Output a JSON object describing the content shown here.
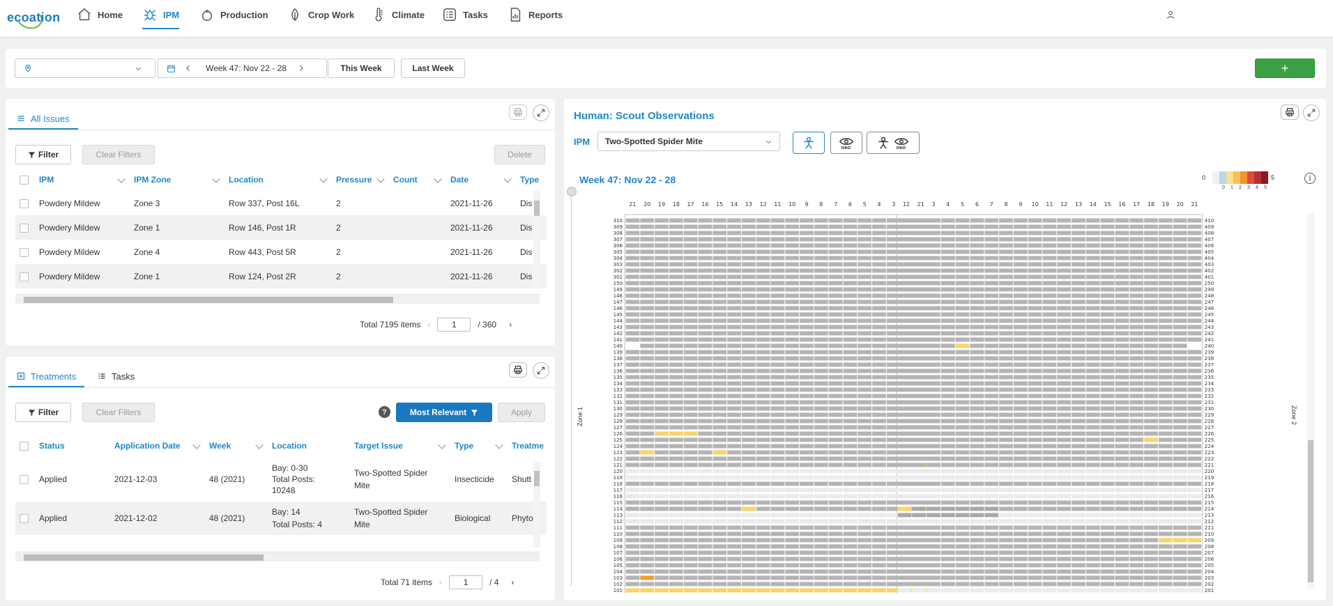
{
  "nav": {
    "logo_text": "ecoation",
    "items": [
      {
        "label": "Home",
        "icon": "home-icon"
      },
      {
        "label": "IPM",
        "icon": "bug-icon",
        "active": true
      },
      {
        "label": "Production",
        "icon": "tomato-icon"
      },
      {
        "label": "Crop Work",
        "icon": "leaf-icon"
      },
      {
        "label": "Climate",
        "icon": "thermometer-icon"
      },
      {
        "label": "Tasks",
        "icon": "checklist-icon"
      },
      {
        "label": "Reports",
        "icon": "report-icon"
      }
    ],
    "user_icon": "user-icon"
  },
  "toolbar": {
    "location_placeholder": "",
    "week_label": "Week 47: Nov 22 - 28",
    "this_week": "This Week",
    "last_week": "Last Week",
    "add_label": "+"
  },
  "issues": {
    "tab_label": "All Issues",
    "filter_label": "Filter",
    "clear_filters_label": "Clear Filters",
    "delete_label": "Delete",
    "columns": [
      "IPM",
      "IPM Zone",
      "Location",
      "Pressure",
      "Count",
      "Date",
      "Type"
    ],
    "rows": [
      {
        "ipm": "Powdery Mildew",
        "zone": "Zone 3",
        "location": "Row 337, Post 16L",
        "pressure": "2",
        "count": "",
        "date": "2021-11-26",
        "type": "Dis"
      },
      {
        "ipm": "Powdery Mildew",
        "zone": "Zone 1",
        "location": "Row 146, Post 1R",
        "pressure": "2",
        "count": "",
        "date": "2021-11-26",
        "type": "Dis"
      },
      {
        "ipm": "Powdery Mildew",
        "zone": "Zone 4",
        "location": "Row 443, Post 5R",
        "pressure": "2",
        "count": "",
        "date": "2021-11-26",
        "type": "Dis"
      },
      {
        "ipm": "Powdery Mildew",
        "zone": "Zone 1",
        "location": "Row 124, Post 2R",
        "pressure": "2",
        "count": "",
        "date": "2021-11-26",
        "type": "Dis"
      }
    ],
    "total_label": "Total 7195 items",
    "page": "1",
    "page_total": "/ 360"
  },
  "treatments": {
    "tab_label": "Treatments",
    "tasks_tab_label": "Tasks",
    "filter_label": "Filter",
    "clear_filters_label": "Clear Filters",
    "most_relevant_label": "Most Relevant",
    "apply_label": "Apply",
    "help_label": "?",
    "columns": [
      "Status",
      "Application Date",
      "Week",
      "Location",
      "Target Issue",
      "Type",
      "Treatme"
    ],
    "rows": [
      {
        "status": "Applied",
        "date": "2021-12-03",
        "week": "48 (2021)",
        "location": [
          "Bay: 0-30",
          "Total Posts:",
          "10248"
        ],
        "target": [
          "Two-Spotted Spider",
          "Mite"
        ],
        "type": "Insecticide",
        "treatment": "Shutt"
      },
      {
        "status": "Applied",
        "date": "2021-12-02",
        "week": "48 (2021)",
        "location": [
          "Bay: 14",
          "Total Posts: 4"
        ],
        "target": [
          "Two-Spotted Spider",
          "Mite"
        ],
        "type": "Biological",
        "treatment": "Phyto"
      }
    ],
    "total_label": "Total 71 items",
    "page": "1",
    "page_total": "/ 4"
  },
  "scout": {
    "title": "Human: Scout Observations",
    "ipm_label": "IPM",
    "pest_select": "Two-Spotted Spider Mite",
    "week_title": "Week 47: Nov 22 - 28",
    "zone_left": "Zone 1",
    "zone_right": "Zone 2",
    "legend_min": "0",
    "legend_max": "5",
    "legend_ticks": [
      "0",
      "1",
      "2",
      "3",
      "4",
      "5"
    ],
    "legend_colors": [
      "#f1f1f1",
      "#b8d8e8",
      "#fde08b",
      "#f6c24f",
      "#f39332",
      "#d94e3c",
      "#b82e33",
      "#8a1a22"
    ],
    "colors": {
      "grey": "#b4b4b4",
      "empty": "#ffffff",
      "light": "#fbd36a",
      "orange": "#f49a2b"
    },
    "left_posts": [
      "21",
      "20",
      "19",
      "18",
      "17",
      "16",
      "15",
      "14",
      "13",
      "12",
      "11",
      "10",
      "9",
      "8",
      "7",
      "6",
      "5",
      "4",
      "3",
      "2",
      "1"
    ],
    "right_posts": [
      "1",
      "2",
      "3",
      "4",
      "5",
      "6",
      "7",
      "8",
      "9",
      "10",
      "11",
      "12",
      "13",
      "14",
      "15",
      "16",
      "17",
      "18",
      "19",
      "20",
      "21"
    ],
    "left_rows": [
      "310",
      "309",
      "308",
      "307",
      "306",
      "305",
      "304",
      "303",
      "302",
      "301",
      "150",
      "149",
      "148",
      "147",
      "146",
      "145",
      "144",
      "143",
      "142",
      "141",
      "140",
      "139",
      "138",
      "137",
      "136",
      "135",
      "134",
      "133",
      "132",
      "131",
      "130",
      "129",
      "128",
      "127",
      "126",
      "125",
      "124",
      "123",
      "122",
      "121",
      "120",
      "119",
      "118",
      "117",
      "116",
      "115",
      "114",
      "113",
      "112",
      "111",
      "110",
      "109",
      "108",
      "107",
      "106",
      "105",
      "104",
      "103",
      "102",
      "101"
    ],
    "right_rows": [
      "410",
      "409",
      "408",
      "407",
      "406",
      "405",
      "404",
      "403",
      "402",
      "401",
      "250",
      "249",
      "248",
      "247",
      "246",
      "245",
      "244",
      "243",
      "242",
      "241",
      "240",
      "239",
      "238",
      "237",
      "236",
      "235",
      "234",
      "233",
      "232",
      "231",
      "230",
      "229",
      "228",
      "227",
      "226",
      "225",
      "224",
      "223",
      "222",
      "221",
      "220",
      "219",
      "218",
      "217",
      "216",
      "215",
      "214",
      "213",
      "212",
      "211",
      "210",
      "209",
      "208",
      "207",
      "206",
      "205",
      "204",
      "203",
      "202",
      "201"
    ]
  }
}
